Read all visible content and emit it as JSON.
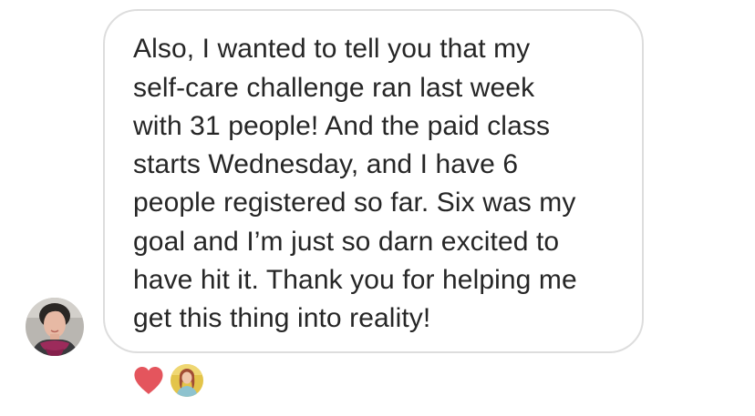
{
  "conversation": {
    "message": {
      "lines": [
        "Also, I wanted to tell you that my",
        "self-care challenge ran last week",
        "with 31 people! And the paid class",
        "starts Wednesday, and I have 6",
        "people registered so far. Six was my",
        "goal and I’m just so darn excited to",
        "have hit it. Thank you for helping me",
        "get this thing into reality!"
      ]
    },
    "reaction": {
      "emoji_icon": "heart-icon",
      "color": "#e4555d"
    }
  }
}
